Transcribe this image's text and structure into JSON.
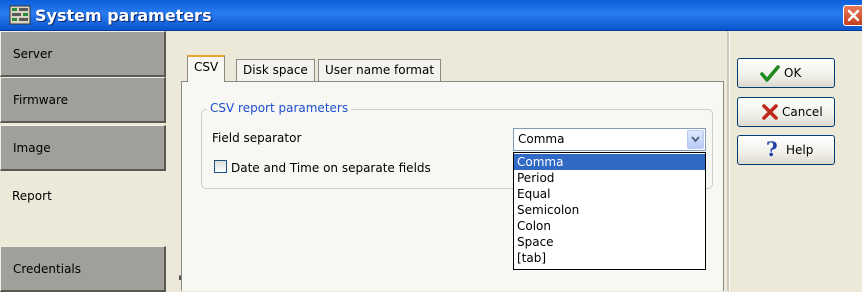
{
  "window": {
    "title": "System parameters",
    "close_icon": "close-icon",
    "app_icon": "grid-settings-icon"
  },
  "nav": {
    "items": [
      {
        "label": "Server",
        "active": false
      },
      {
        "label": "Firmware",
        "active": false
      },
      {
        "label": "Image",
        "active": false
      },
      {
        "label": "Report",
        "active": true
      },
      {
        "label": "Credentials",
        "active": false
      }
    ]
  },
  "tabs": [
    {
      "label": "CSV",
      "active": true
    },
    {
      "label": "Disk space",
      "active": false
    },
    {
      "label": "User name format",
      "active": false
    }
  ],
  "csv": {
    "group_title": "CSV report parameters",
    "field_separator_label": "Field separator",
    "field_separator_value": "Comma",
    "checkbox_label": "Date and Time on separate fields",
    "checkbox_checked": false,
    "options": [
      "Comma",
      "Period",
      "Equal",
      "Semicolon",
      "Colon",
      "Space",
      "[tab]"
    ],
    "highlighted_option": "Comma"
  },
  "buttons": {
    "ok": {
      "label": "OK",
      "icon": "check-icon",
      "color": "#1f8a1f"
    },
    "cancel": {
      "label": "Cancel",
      "icon": "x-icon",
      "color": "#c0281c"
    },
    "help": {
      "label": "Help",
      "icon": "question-icon",
      "color": "#1f3fa8"
    }
  },
  "colors": {
    "titlebar": "#0a5fd8",
    "selection": "#316ac5",
    "tab_accent": "#e8a430",
    "group_title": "#1e4fd0"
  }
}
